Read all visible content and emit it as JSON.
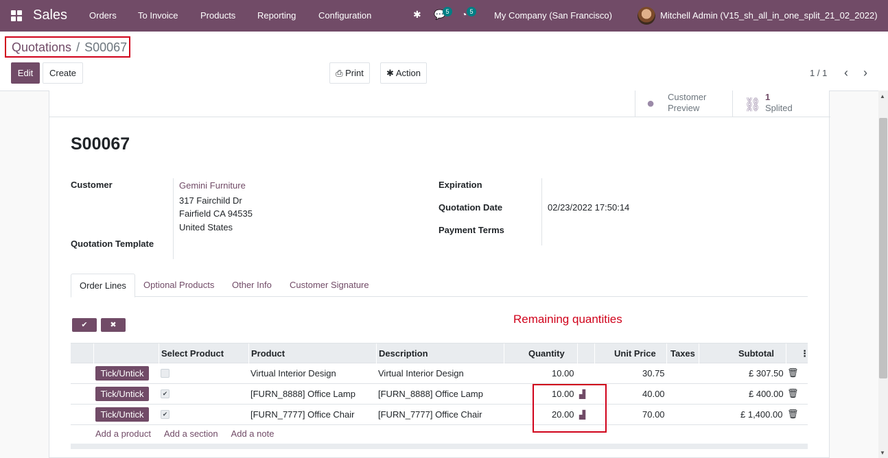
{
  "nav": {
    "app_name": "Sales",
    "menus": [
      "Orders",
      "To Invoice",
      "Products",
      "Reporting",
      "Configuration"
    ],
    "messages_count": "5",
    "activities_count": "5",
    "company": "My Company (San Francisco)",
    "user": "Mitchell Admin (V15_sh_all_in_one_split_21_02_2022)"
  },
  "breadcrumb": {
    "parent": "Quotations",
    "separator": "/",
    "current": "S00067"
  },
  "toolbar": {
    "edit": "Edit",
    "create": "Create",
    "print": "Print",
    "action": "Action"
  },
  "pager": {
    "value": "1 / 1"
  },
  "smart_buttons": {
    "preview_l1": "Customer",
    "preview_l2": "Preview",
    "split_count": "1",
    "split_label": "Splited"
  },
  "record": {
    "title": "S00067",
    "customer_label": "Customer",
    "customer_name": "Gemini Furniture",
    "address_line1": "317 Fairchild Dr",
    "address_line2": "Fairfield CA 94535",
    "address_line3": "United States",
    "template_label": "Quotation Template",
    "expiration_label": "Expiration",
    "quotation_date_label": "Quotation Date",
    "quotation_date": "02/23/2022 17:50:14",
    "payment_terms_label": "Payment Terms"
  },
  "tabs": [
    "Order Lines",
    "Optional Products",
    "Other Info",
    "Customer Signature"
  ],
  "annotation": "Remaining quantities",
  "table": {
    "headers": {
      "select_product": "Select Product",
      "product": "Product",
      "description": "Description",
      "quantity": "Quantity",
      "unit_price": "Unit Price",
      "taxes": "Taxes",
      "subtotal": "Subtotal"
    },
    "rows": [
      {
        "button": "Tick/Untick",
        "checked": false,
        "product": "Virtual Interior Design",
        "description": "Virtual Interior Design",
        "quantity": "10.00",
        "unit_price": "30.75",
        "subtotal": "£ 307.50"
      },
      {
        "button": "Tick/Untick",
        "checked": true,
        "product": "[FURN_8888] Office Lamp",
        "description": "[FURN_8888] Office Lamp",
        "quantity": "10.00",
        "unit_price": "40.00",
        "subtotal": "£ 400.00"
      },
      {
        "button": "Tick/Untick",
        "checked": true,
        "product": "[FURN_7777] Office Chair",
        "description": "[FURN_7777] Office Chair",
        "quantity": "20.00",
        "unit_price": "70.00",
        "subtotal": "£ 1,400.00"
      }
    ],
    "add_links": {
      "product": "Add a product",
      "section": "Add a section",
      "note": "Add a note"
    }
  }
}
